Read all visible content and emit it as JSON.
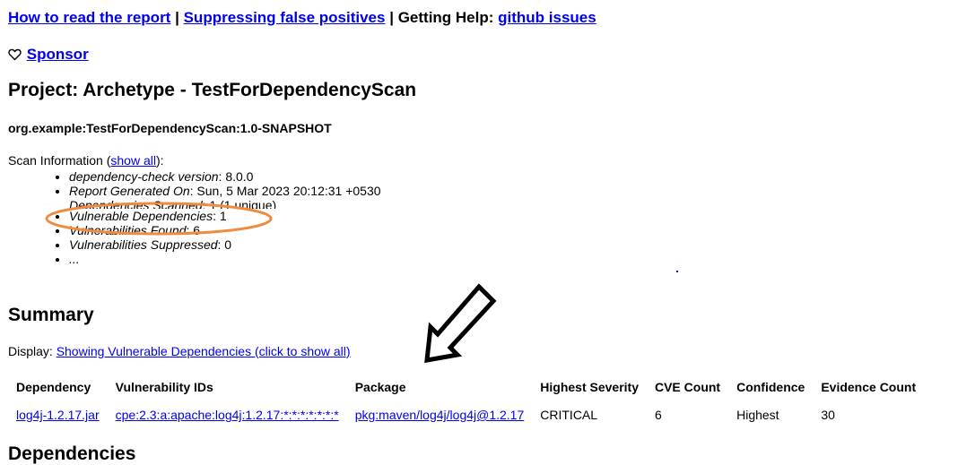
{
  "nav": {
    "how_to_read": "How to read the report",
    "sep1": "|",
    "suppressing": "Suppressing false positives",
    "sep2": "|",
    "getting_help_label": "Getting Help:",
    "github_issues": "github issues"
  },
  "sponsor": {
    "icon": "heart-icon",
    "label": "Sponsor"
  },
  "project": {
    "title": "Project: Archetype - TestForDependencyScan",
    "artifact": "org.example:TestForDependencyScan:1.0-SNAPSHOT"
  },
  "scan": {
    "label": "Scan Information (",
    "show_all": "show all",
    "label_end": "):",
    "items": [
      {
        "key": "dependency-check version",
        "value": ": 8.0.0"
      },
      {
        "key": "Report Generated On",
        "value": ": Sun, 5 Mar 2023 20:12:31 +0530"
      },
      {
        "key": "Dependencies Scanned",
        "value": ": 1 (1 unique)"
      },
      {
        "key": "Vulnerable Dependencies",
        "value": ": 1"
      },
      {
        "key": "Vulnerabilities Found",
        "value": ": 6"
      },
      {
        "key": "Vulnerabilities Suppressed",
        "value": ": 0"
      },
      {
        "key": "...",
        "value": ""
      }
    ]
  },
  "annotations": {
    "oval_color": "#f08a3c",
    "arrow_color": "#000000"
  },
  "summary": {
    "heading": "Summary",
    "display_label": "Display:",
    "display_link": "Showing Vulnerable Dependencies (click to show all)",
    "columns": [
      "Dependency",
      "Vulnerability IDs",
      "Package",
      "Highest Severity",
      "CVE Count",
      "Confidence",
      "Evidence Count"
    ],
    "rows": [
      {
        "dependency": "log4j-1.2.17.jar",
        "vuln_ids": "cpe:2.3:a:apache:log4j:1.2.17:*:*:*:*:*:*:*",
        "package": "pkg:maven/log4j/log4j@1.2.17",
        "severity": "CRITICAL",
        "cve_count": "6",
        "confidence": "Highest",
        "evidence_count": "30"
      }
    ]
  },
  "next_heading": "Dependencies"
}
